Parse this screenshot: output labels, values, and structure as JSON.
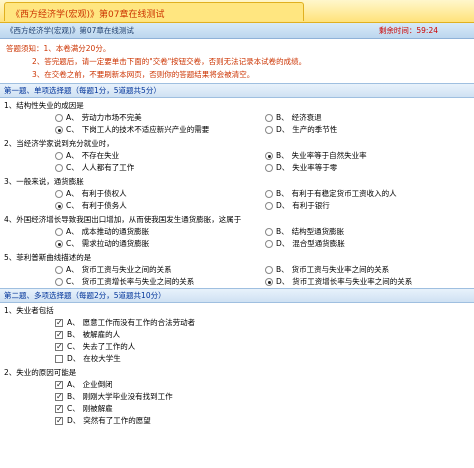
{
  "window": {
    "tab_title": "《西方经济学(宏观)》第07章在线测试"
  },
  "header": {
    "doc_title": "《西方经济学(宏观)》第07章在线测试",
    "timer_label": "剩余时间：",
    "timer_value": "59:24"
  },
  "notes": {
    "line1": "答题须知：1、本卷满分20分。",
    "line2": "2、答完题后，请一定要单击下面的\"交卷\"按钮交卷，否则无法记录本试卷的成绩。",
    "line3": "3、在交卷之前，不要刷新本网页，否则你的答题结果将会被清空。"
  },
  "section1": {
    "title": "第一题、单项选择题（每题1分，5道题共5分）",
    "questions": [
      {
        "title": "1、结构性失业的成因是",
        "options": [
          {
            "letter": "A、",
            "text": "劳动力市场不完美",
            "selected": false
          },
          {
            "letter": "B、",
            "text": "经济衰退",
            "selected": false
          },
          {
            "letter": "C、",
            "text": "下岗工人的技术不适应新兴产业的需要",
            "selected": true
          },
          {
            "letter": "D、",
            "text": "生产的季节性",
            "selected": false
          }
        ]
      },
      {
        "title": "2、当经济学家说到充分就业时，",
        "options": [
          {
            "letter": "A、",
            "text": "不存在失业",
            "selected": false
          },
          {
            "letter": "B、",
            "text": "失业率等于自然失业率",
            "selected": true
          },
          {
            "letter": "C、",
            "text": "人人都有了工作",
            "selected": false
          },
          {
            "letter": "D、",
            "text": "失业率等于零",
            "selected": false
          }
        ]
      },
      {
        "title": "3、一般来说，通货膨胀",
        "options": [
          {
            "letter": "A、",
            "text": "有利于债权人",
            "selected": false
          },
          {
            "letter": "B、",
            "text": "有利于有稳定货币工资收入的人",
            "selected": false
          },
          {
            "letter": "C、",
            "text": "有利于债务人",
            "selected": true
          },
          {
            "letter": "D、",
            "text": "有利于银行",
            "selected": false
          }
        ]
      },
      {
        "title": "4、外国经济增长导致我国出口增加，从而使我国发生通货膨胀，这属于",
        "options": [
          {
            "letter": "A、",
            "text": "成本推动的通货膨胀",
            "selected": false
          },
          {
            "letter": "B、",
            "text": "结构型通货膨胀",
            "selected": false
          },
          {
            "letter": "C、",
            "text": "需求拉动的通货膨胀",
            "selected": true
          },
          {
            "letter": "D、",
            "text": "混合型通货膨胀",
            "selected": false
          }
        ]
      },
      {
        "title": "5、菲利普斯曲线描述的是",
        "options": [
          {
            "letter": "A、",
            "text": "货币工资与失业之间的关系",
            "selected": false
          },
          {
            "letter": "B、",
            "text": "货币工资与失业率之间的关系",
            "selected": false
          },
          {
            "letter": "C、",
            "text": "货币工资增长率与失业之间的关系",
            "selected": false
          },
          {
            "letter": "D、",
            "text": "货币工资增长率与失业率之间的关系",
            "selected": true
          }
        ]
      }
    ]
  },
  "section2": {
    "title": "第二题、多项选择题（每题2分，5道题共10分）",
    "questions": [
      {
        "title": "1、失业者包括",
        "options": [
          {
            "letter": "A、",
            "text": "愿意工作而没有工作的合法劳动者",
            "checked": true
          },
          {
            "letter": "B、",
            "text": "被解雇的人",
            "checked": true
          },
          {
            "letter": "C、",
            "text": "失去了工作的人",
            "checked": true
          },
          {
            "letter": "D、",
            "text": "在校大学生",
            "checked": false
          }
        ]
      },
      {
        "title": "2、失业的原因可能是",
        "options": [
          {
            "letter": "A、",
            "text": "企业倒闭",
            "checked": true
          },
          {
            "letter": "B、",
            "text": "刚刚大学毕业没有找到工作",
            "checked": true
          },
          {
            "letter": "C、",
            "text": "刚被解雇",
            "checked": true
          },
          {
            "letter": "D、",
            "text": "突然有了工作的愿望",
            "checked": true
          }
        ]
      }
    ]
  }
}
